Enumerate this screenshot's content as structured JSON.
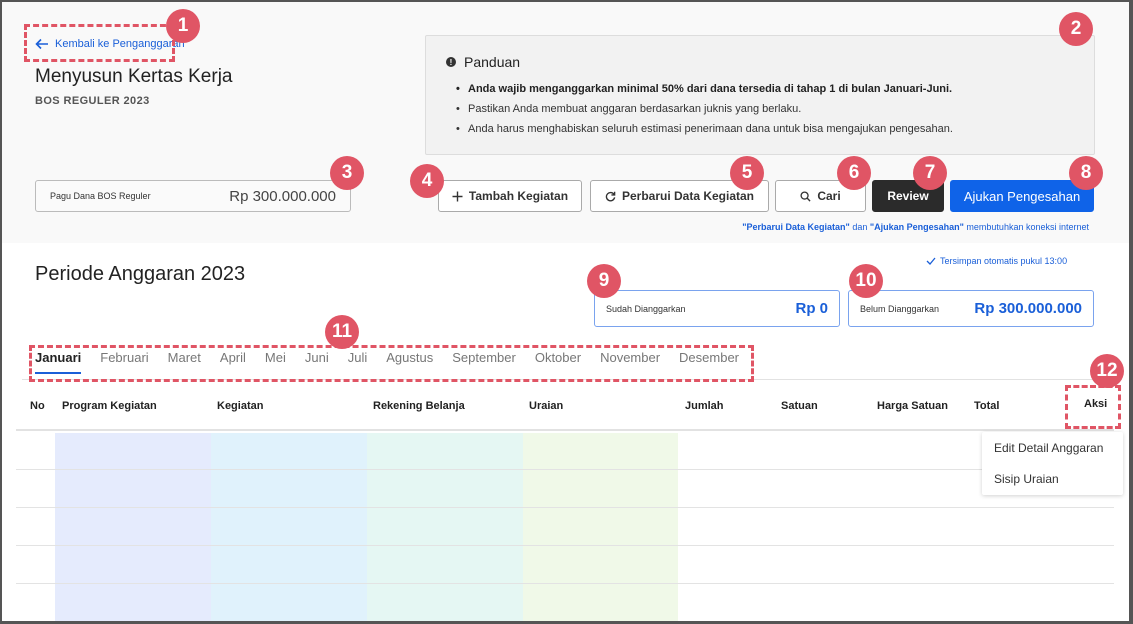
{
  "header": {
    "back_link": "Kembali ke Penganggaran",
    "title": "Menyusun Kertas Kerja",
    "subtitle": "BOS REGULER 2023"
  },
  "guide": {
    "title": "Panduan",
    "items": [
      "Anda wajib menganggarkan minimal 50% dari dana tersedia di tahap 1 di bulan Januari-Juni.",
      "Pastikan Anda membuat anggaran berdasarkan juknis yang berlaku.",
      "Anda harus menghabiskan seluruh estimasi penerimaan dana untuk bisa mengajukan pengesahan."
    ]
  },
  "pagu": {
    "label": "Pagu Dana BOS Reguler",
    "value": "Rp 300.000.000"
  },
  "toolbar": {
    "tambah_label": "Tambah Kegiatan",
    "perbarui_label": "Perbarui Data Kegiatan",
    "cari_label": "Cari",
    "review_label": "Review",
    "ajukan_label": "Ajukan Pengesahan"
  },
  "connection_note": {
    "part1": "\"Perbarui Data Kegiatan\"",
    "part2": " dan ",
    "part3": "\"Ajukan Pengesahan\"",
    "part4": " membutuhkan koneksi internet"
  },
  "period": {
    "title": "Periode Anggaran 2023",
    "autosave": "Tersimpan otomatis pukul 13:00",
    "sudah_label": "Sudah Dianggarkan",
    "sudah_value": "Rp 0",
    "belum_label": "Belum Dianggarkan",
    "belum_value": "Rp 300.000.000"
  },
  "tabs": [
    "Januari",
    "Februari",
    "Maret",
    "April",
    "Mei",
    "Juni",
    "Juli",
    "Agustus",
    "September",
    "Oktober",
    "November",
    "Desember"
  ],
  "active_tab": "Januari",
  "table": {
    "columns": [
      "No",
      "Program Kegiatan",
      "Kegiatan",
      "Rekening Belanja",
      "Uraian",
      "Jumlah",
      "Satuan",
      "Harga Satuan",
      "Total",
      "Aksi"
    ],
    "column_colors": [
      "#e5ebfd",
      "#e0f2fc",
      "#e5f7f3",
      "#f0f9e8"
    ]
  },
  "action_menu": {
    "items": [
      "Edit Detail Anggaran",
      "Sisip Uraian"
    ]
  },
  "annotations": [
    "1",
    "2",
    "3",
    "4",
    "5",
    "6",
    "7",
    "8",
    "9",
    "10",
    "11",
    "12"
  ],
  "colors": {
    "accent": "#0f63e8",
    "link": "#1a5fd8",
    "dark_button": "#2b2b2b",
    "annotation": "#e05565"
  }
}
